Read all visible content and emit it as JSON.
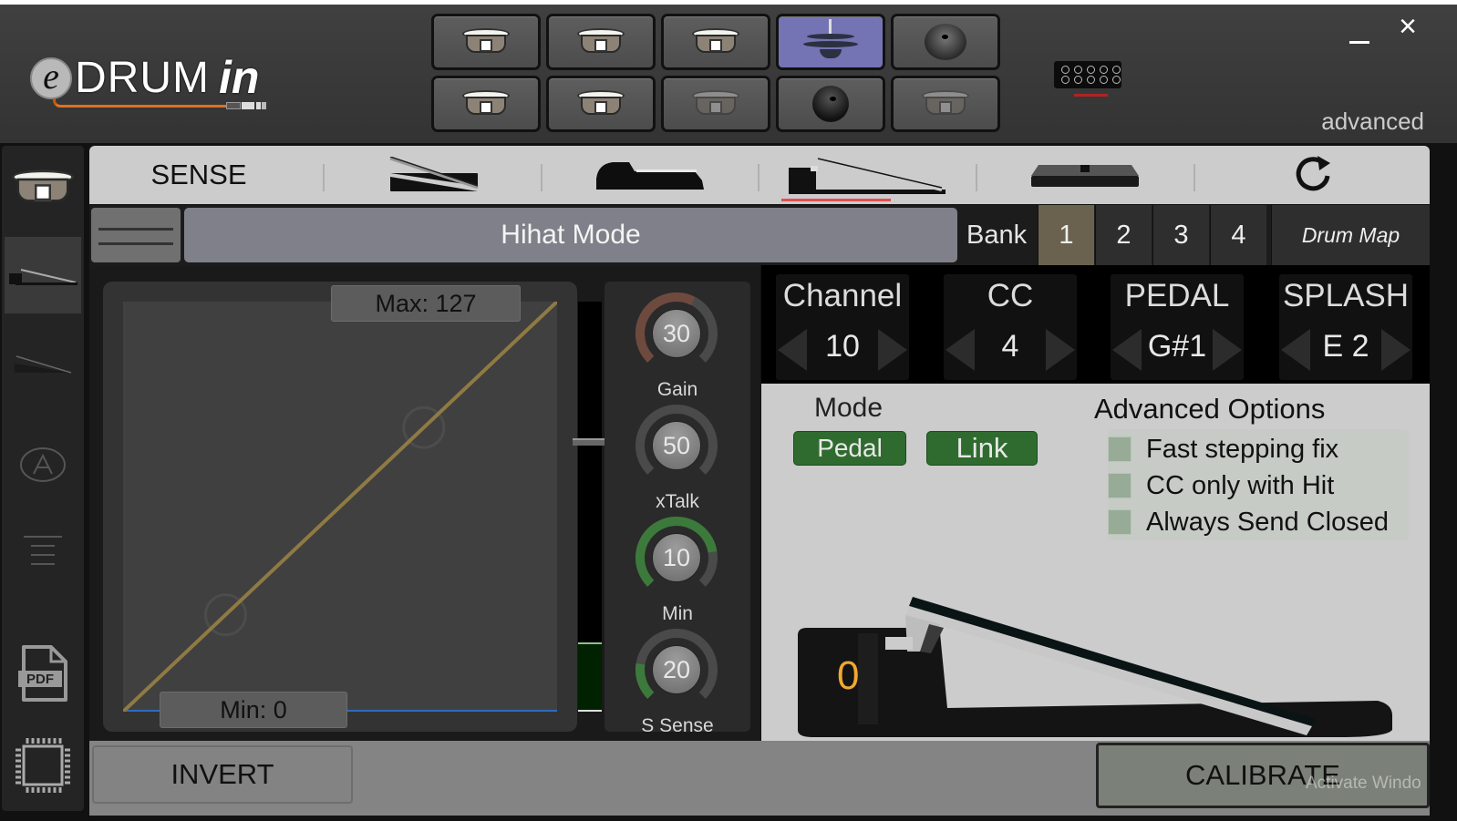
{
  "app": {
    "logo_e": "e",
    "logo_drum": "DRUM",
    "logo_in": "in",
    "mode_label": "advanced",
    "minimize_icon": "minimize-icon",
    "close_icon": "×"
  },
  "pad_selector": {
    "pads": [
      {
        "icon": "snare-drum-icon",
        "state": "normal"
      },
      {
        "icon": "snare-drum-icon",
        "state": "normal"
      },
      {
        "icon": "snare-drum-icon",
        "state": "normal"
      },
      {
        "icon": "hihat-icon",
        "state": "active"
      },
      {
        "icon": "cymbal-icon",
        "state": "normal"
      },
      {
        "icon": "snare-drum-icon",
        "state": "normal"
      },
      {
        "icon": "snare-drum-icon",
        "state": "normal"
      },
      {
        "icon": "snare-drum-icon",
        "state": "dim"
      },
      {
        "icon": "cymbal-dark-icon",
        "state": "normal"
      },
      {
        "icon": "snare-drum-icon",
        "state": "dim"
      }
    ]
  },
  "sidebar": {
    "items": [
      {
        "icon": "snare-drum-icon"
      },
      {
        "icon": "hihat-pedal-icon",
        "selected": true
      },
      {
        "icon": "expression-pedal-icon"
      },
      {
        "icon": "auto-a-icon"
      },
      {
        "icon": "menu-lines-icon"
      },
      {
        "icon": "pdf-icon",
        "label": "PDF"
      },
      {
        "icon": "chip-icon"
      }
    ]
  },
  "tabs": {
    "sense": "SENSE",
    "items": [
      {
        "icon": "expression-pedal-icon"
      },
      {
        "icon": "sustain-pedal-icon"
      },
      {
        "icon": "hihat-pedal-icon",
        "selected": true
      },
      {
        "icon": "footswitch-icon"
      },
      {
        "icon": "refresh-icon"
      }
    ]
  },
  "mode_row": {
    "title": "Hihat Mode",
    "bank_label": "Bank",
    "banks": [
      "1",
      "2",
      "3",
      "4"
    ],
    "active_bank": "1",
    "drum_map": "Drum Map"
  },
  "curve": {
    "max_label": "Max: 127",
    "min_label": "Min: 0",
    "input_range": [
      0,
      127
    ],
    "output_range": [
      0,
      127
    ],
    "points": [
      [
        0,
        0
      ],
      [
        127,
        127
      ]
    ],
    "handles": [
      [
        30,
        30
      ],
      [
        88,
        88
      ]
    ],
    "level": 0.17,
    "colors": {
      "curve": "#8f7a44",
      "baseline": "#2d6cc0"
    }
  },
  "knobs": [
    {
      "label": "Gain",
      "value": "30",
      "fraction": 0.6,
      "color": "#6e4a3e"
    },
    {
      "label": "xTalk",
      "value": "50",
      "fraction": 0.0,
      "color": "#555"
    },
    {
      "label": "Min",
      "value": "10",
      "fraction": 0.8,
      "color": "#3c7a3c"
    },
    {
      "label": "S Sense",
      "value": "20",
      "fraction": 0.2,
      "color": "#3c7a3c"
    }
  ],
  "midi": [
    {
      "title": "Channel",
      "value": "10"
    },
    {
      "title": "CC",
      "value": "4"
    },
    {
      "title": "PEDAL",
      "value": "G#1"
    },
    {
      "title": "SPLASH",
      "value": "E 2"
    }
  ],
  "options": {
    "mode_label": "Mode",
    "pedal_btn": "Pedal",
    "link_btn": "Link",
    "advanced_title": "Advanced Options",
    "advanced": [
      {
        "label": "Fast stepping fix",
        "checked": false
      },
      {
        "label": "CC only with Hit",
        "checked": false
      },
      {
        "label": "Always Send Closed",
        "checked": false
      }
    ],
    "pedal_value": "0"
  },
  "bottom": {
    "invert": "INVERT",
    "calibrate": "CALIBRATE",
    "watermark": "Activate Windo"
  }
}
